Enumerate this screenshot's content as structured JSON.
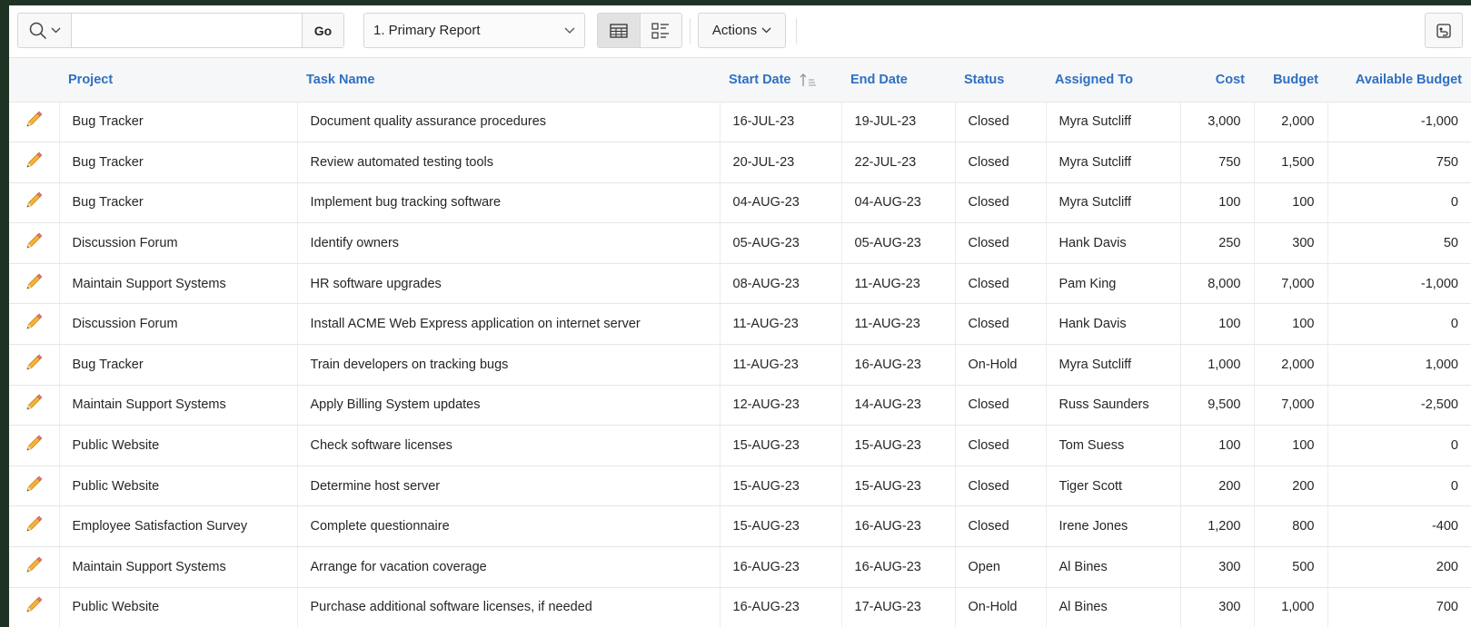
{
  "toolbar": {
    "search_icon": "search-icon",
    "search_value": "",
    "go_label": "Go",
    "report_label": "1. Primary Report",
    "view_icons": [
      "grid-view-icon",
      "detail-view-icon"
    ],
    "actions_label": "Actions",
    "reset_icon": "reset-icon"
  },
  "colors": {
    "accent": "#2f6fc3",
    "pencil": "#f2a71b",
    "background": "#1f3324"
  },
  "table": {
    "columns": {
      "project": "Project",
      "task": "Task Name",
      "start": "Start Date",
      "end": "End Date",
      "status": "Status",
      "assigned": "Assigned To",
      "cost": "Cost",
      "budget": "Budget",
      "available": "Available Budget"
    },
    "sorted_column": "start",
    "sort_direction": "ascending",
    "rows": [
      {
        "project": "Bug Tracker",
        "task": "Document quality assurance procedures",
        "start": "16-JUL-23",
        "end": "19-JUL-23",
        "status": "Closed",
        "assigned": "Myra Sutcliff",
        "cost": "3,000",
        "budget": "2,000",
        "available": "-1,000"
      },
      {
        "project": "Bug Tracker",
        "task": "Review automated testing tools",
        "start": "20-JUL-23",
        "end": "22-JUL-23",
        "status": "Closed",
        "assigned": "Myra Sutcliff",
        "cost": "750",
        "budget": "1,500",
        "available": "750"
      },
      {
        "project": "Bug Tracker",
        "task": "Implement bug tracking software",
        "start": "04-AUG-23",
        "end": "04-AUG-23",
        "status": "Closed",
        "assigned": "Myra Sutcliff",
        "cost": "100",
        "budget": "100",
        "available": "0"
      },
      {
        "project": "Discussion Forum",
        "task": "Identify owners",
        "start": "05-AUG-23",
        "end": "05-AUG-23",
        "status": "Closed",
        "assigned": "Hank Davis",
        "cost": "250",
        "budget": "300",
        "available": "50"
      },
      {
        "project": "Maintain Support Systems",
        "task": "HR software upgrades",
        "start": "08-AUG-23",
        "end": "11-AUG-23",
        "status": "Closed",
        "assigned": "Pam King",
        "cost": "8,000",
        "budget": "7,000",
        "available": "-1,000"
      },
      {
        "project": "Discussion Forum",
        "task": "Install ACME Web Express application on internet server",
        "start": "11-AUG-23",
        "end": "11-AUG-23",
        "status": "Closed",
        "assigned": "Hank Davis",
        "cost": "100",
        "budget": "100",
        "available": "0"
      },
      {
        "project": "Bug Tracker",
        "task": "Train developers on tracking bugs",
        "start": "11-AUG-23",
        "end": "16-AUG-23",
        "status": "On-Hold",
        "assigned": "Myra Sutcliff",
        "cost": "1,000",
        "budget": "2,000",
        "available": "1,000"
      },
      {
        "project": "Maintain Support Systems",
        "task": "Apply Billing System updates",
        "start": "12-AUG-23",
        "end": "14-AUG-23",
        "status": "Closed",
        "assigned": "Russ Saunders",
        "cost": "9,500",
        "budget": "7,000",
        "available": "-2,500"
      },
      {
        "project": "Public Website",
        "task": "Check software licenses",
        "start": "15-AUG-23",
        "end": "15-AUG-23",
        "status": "Closed",
        "assigned": "Tom Suess",
        "cost": "100",
        "budget": "100",
        "available": "0"
      },
      {
        "project": "Public Website",
        "task": "Determine host server",
        "start": "15-AUG-23",
        "end": "15-AUG-23",
        "status": "Closed",
        "assigned": "Tiger Scott",
        "cost": "200",
        "budget": "200",
        "available": "0"
      },
      {
        "project": "Employee Satisfaction Survey",
        "task": "Complete questionnaire",
        "start": "15-AUG-23",
        "end": "16-AUG-23",
        "status": "Closed",
        "assigned": "Irene Jones",
        "cost": "1,200",
        "budget": "800",
        "available": "-400"
      },
      {
        "project": "Maintain Support Systems",
        "task": "Arrange for vacation coverage",
        "start": "16-AUG-23",
        "end": "16-AUG-23",
        "status": "Open",
        "assigned": "Al Bines",
        "cost": "300",
        "budget": "500",
        "available": "200"
      },
      {
        "project": "Public Website",
        "task": "Purchase additional software licenses, if needed",
        "start": "16-AUG-23",
        "end": "17-AUG-23",
        "status": "On-Hold",
        "assigned": "Al Bines",
        "cost": "300",
        "budget": "1,000",
        "available": "700"
      }
    ]
  }
}
